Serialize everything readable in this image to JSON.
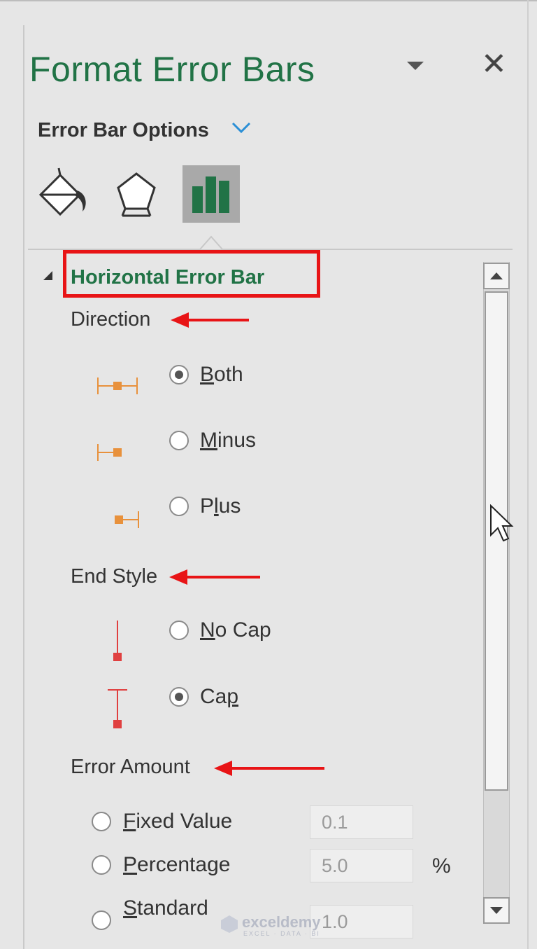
{
  "panel": {
    "title": "Format Error Bars",
    "options_label": "Error Bar Options",
    "section_title": "Horizontal Error Bar"
  },
  "tabs": [
    {
      "name": "fill-line",
      "icon": "paint-bucket-icon",
      "selected": false
    },
    {
      "name": "effects",
      "icon": "pentagon-icon",
      "selected": false
    },
    {
      "name": "error-bar-options",
      "icon": "bar-chart-icon",
      "selected": true
    }
  ],
  "direction": {
    "label": "Direction",
    "options": [
      {
        "pre": "",
        "key": "B",
        "post": "oth",
        "checked": true
      },
      {
        "pre": "",
        "key": "M",
        "post": "inus",
        "checked": false
      },
      {
        "pre": "P",
        "key": "l",
        "post": "us",
        "checked": false
      }
    ]
  },
  "end_style": {
    "label": "End Style",
    "options": [
      {
        "pre": "",
        "key": "N",
        "post": "o Cap",
        "checked": false
      },
      {
        "pre": "Ca",
        "key": "p",
        "post": "",
        "checked": true
      }
    ]
  },
  "error_amount": {
    "label": "Error Amount",
    "fixed": {
      "key": "F",
      "post": "ixed Value",
      "value": "0.1"
    },
    "percentage": {
      "key": "P",
      "post": "ercentage",
      "value": "5.0",
      "unit": "%"
    },
    "standard": {
      "key": "S",
      "post": "tandard",
      "value": "1.0"
    }
  },
  "watermark": {
    "name": "exceldemy",
    "tagline": "EXCEL · DATA · BI"
  },
  "colors": {
    "accent_green": "#217346",
    "annotation_red": "#e81416",
    "icon_orange": "#e8913c"
  }
}
